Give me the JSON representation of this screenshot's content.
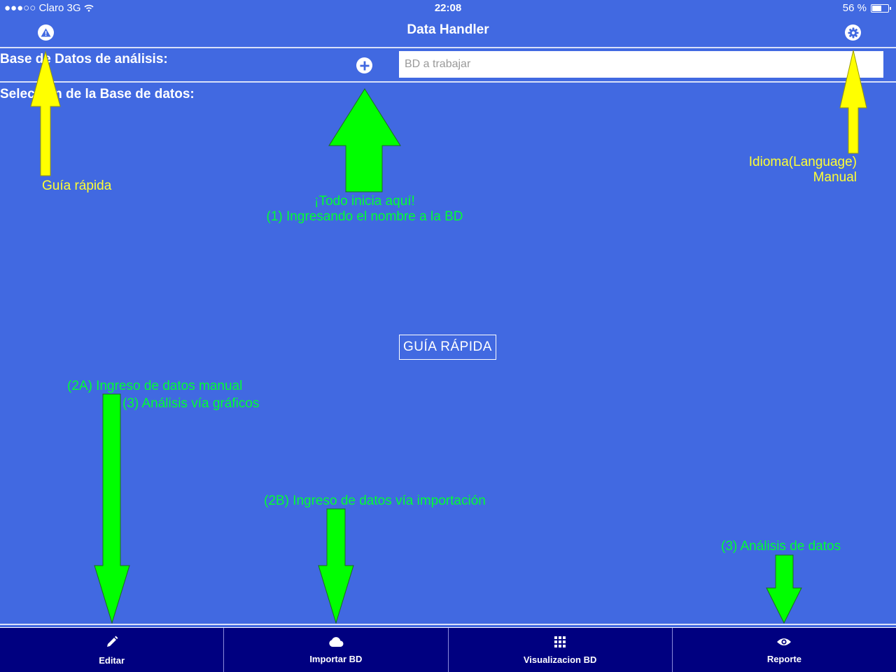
{
  "status_bar": {
    "carrier": "●●●○○ Claro 3G",
    "time": "22:08",
    "battery": "56 %"
  },
  "nav": {
    "title": "Data Handler",
    "left_icon": "warning-icon",
    "right_icon": "gear-icon"
  },
  "rows": {
    "database_label": "Base de Datos de análisis:",
    "add_icon": "plus-circle-icon",
    "input_placeholder": "BD a trabajar",
    "input_value": "",
    "selection_label": "Selección de la Base de datos:"
  },
  "guide_button": "GUÍA RÁPIDA",
  "annotations": {
    "quick_guide": "Guía rápida",
    "language_line1": "Idioma(Language)",
    "language_line2": "Manual",
    "start_line1": "¡Todo inicia aquí!",
    "start_line2": "(1) Ingresando el nombre a la BD",
    "manual_line1": "(2A) Ingreso de datos manual",
    "manual_line2": "(3) Análisis vía gráficos",
    "import": "(2B) Ingreso de datos vía importación",
    "analysis": "(3) Análisis de datos"
  },
  "tabs": [
    {
      "label": "Editar",
      "icon": "pencil-icon"
    },
    {
      "label": "Importar BD",
      "icon": "cloud-icon"
    },
    {
      "label": "Visualizacion BD",
      "icon": "grid-icon"
    },
    {
      "label": "Reporte",
      "icon": "eye-icon"
    }
  ],
  "colors": {
    "background": "#4169E1",
    "tab_bar": "#000080",
    "yellow_annotation": "#FFFF33",
    "green_annotation": "#00FF33"
  }
}
